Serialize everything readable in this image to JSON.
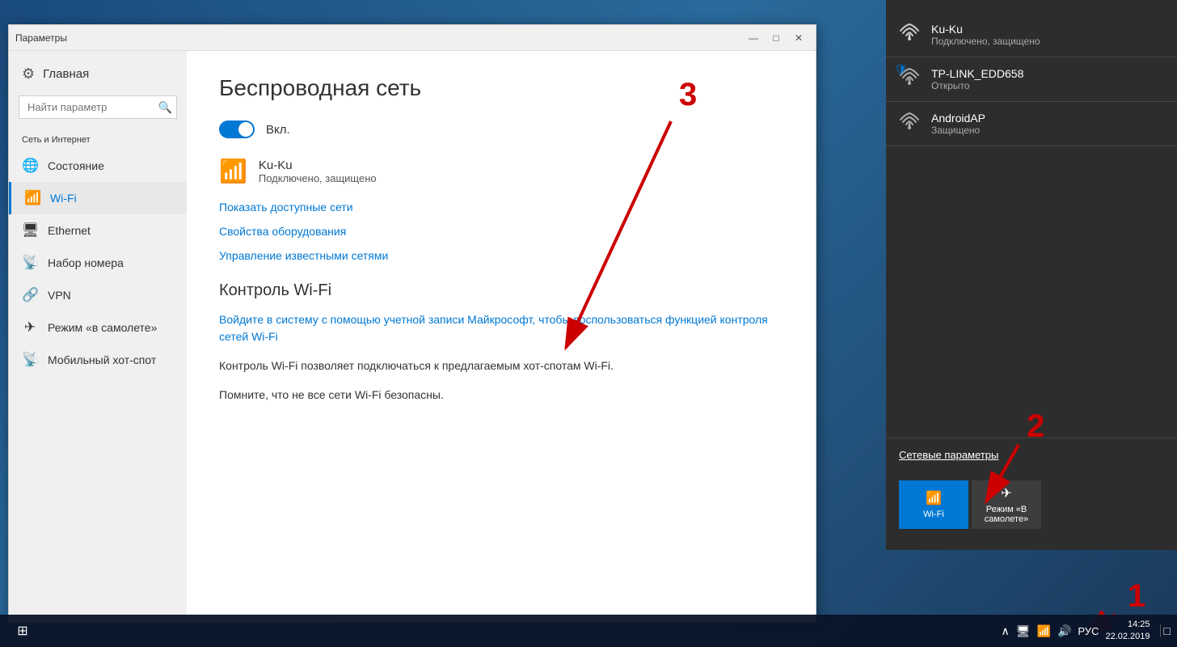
{
  "window": {
    "title": "Параметры",
    "controls": {
      "minimize": "—",
      "maximize": "□",
      "close": "✕"
    }
  },
  "sidebar": {
    "home_label": "Главная",
    "search_placeholder": "Найти параметр",
    "section_label": "Сеть и Интернет",
    "items": [
      {
        "id": "status",
        "icon": "🌐",
        "label": "Состояние"
      },
      {
        "id": "wifi",
        "icon": "📶",
        "label": "Wi-Fi",
        "active": true
      },
      {
        "id": "ethernet",
        "icon": "🖥",
        "label": "Ethernet"
      },
      {
        "id": "dialup",
        "icon": "📡",
        "label": "Набор номера"
      },
      {
        "id": "vpn",
        "icon": "🔗",
        "label": "VPN"
      },
      {
        "id": "airplane",
        "icon": "✈",
        "label": "Режим «в самолете»"
      },
      {
        "id": "hotspot",
        "icon": "📶",
        "label": "Мобильный хот-спот"
      }
    ]
  },
  "main": {
    "page_title": "Беспроводная сеть",
    "toggle_label": "Вкл.",
    "connected_network": {
      "name": "Ku-Ku",
      "status": "Подключено, защищено"
    },
    "links": [
      "Показать доступные сети",
      "Свойства оборудования",
      "Управление известными сетями"
    ],
    "wifi_sense_title": "Контроль Wi-Fi",
    "wifi_sense_link": "Войдите в систему с помощью учетной записи Майкрософт, чтобы воспользоваться функцией контроля сетей Wi-Fi",
    "wifi_sense_text1": "Контроль Wi-Fi позволяет подключаться к предлагаемым хот-спотам Wi-Fi.",
    "wifi_sense_text2": "Помните, что не все сети Wi-Fi безопасны."
  },
  "flyout": {
    "networks": [
      {
        "name": "Ku-Ku",
        "status": "Подключено, защищено",
        "shield": false,
        "connected": true
      },
      {
        "name": "TP-LINK_EDD658",
        "status": "Открыто",
        "shield": true,
        "connected": false
      },
      {
        "name": "AndroidAP",
        "status": "Защищено",
        "shield": false,
        "connected": false
      }
    ],
    "footer": {
      "network_settings_label": "Сетевые параметры"
    },
    "quick_actions": [
      {
        "id": "wifi",
        "label": "Wi-Fi",
        "active": true
      },
      {
        "id": "airplane",
        "label": "Режим «В самолете»",
        "active": false
      }
    ]
  },
  "taskbar": {
    "tray": {
      "time": "14:25",
      "date": "22.02.2019",
      "language": "РУС"
    }
  },
  "annotations": {
    "num1": "1",
    "num2": "2",
    "num3": "3"
  }
}
